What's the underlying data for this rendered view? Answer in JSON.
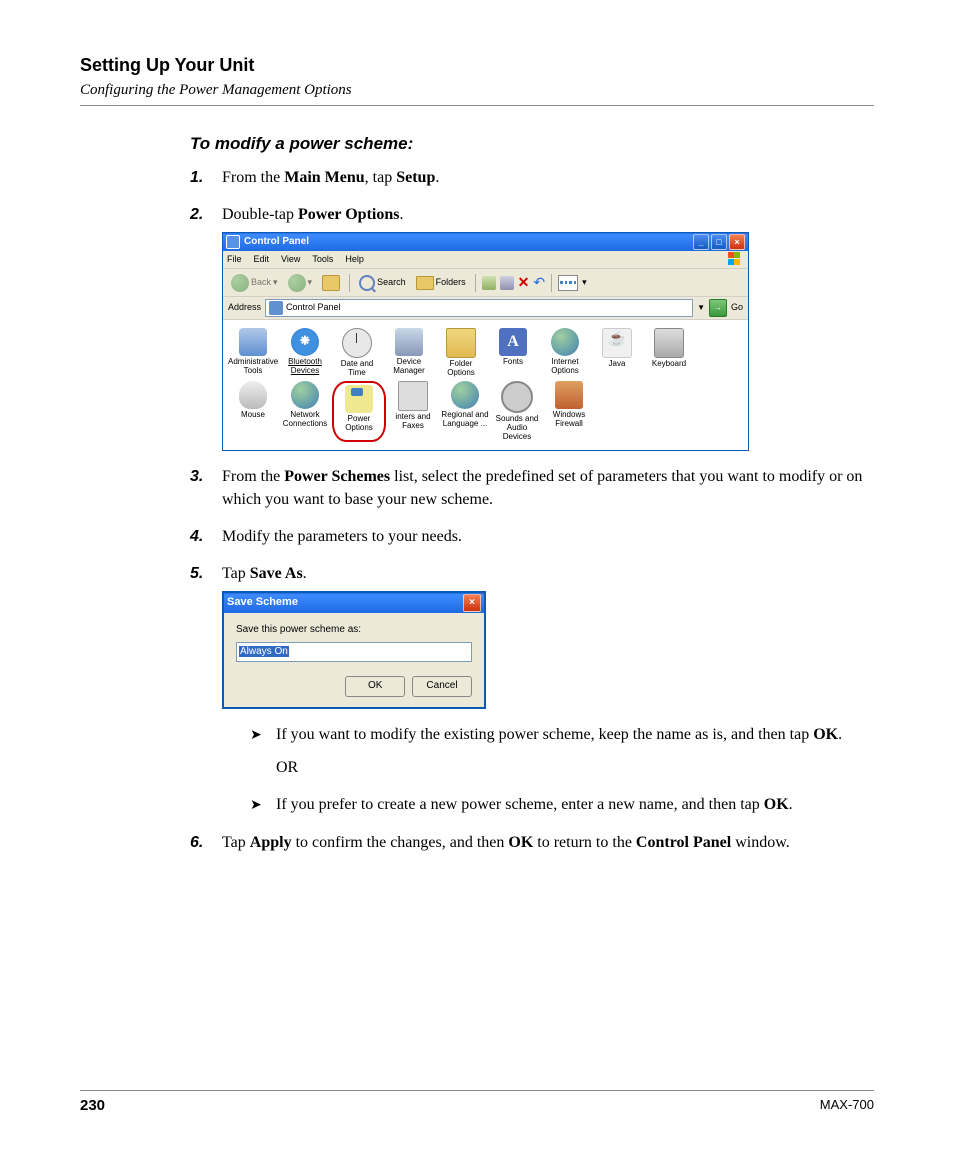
{
  "header": {
    "title": "Setting Up Your Unit",
    "subtitle": "Configuring the Power Management Options"
  },
  "instr_title": "To modify a power scheme:",
  "steps": {
    "s1": {
      "n": "1.",
      "pre": "From the ",
      "b1": "Main Menu",
      "mid": ", tap ",
      "b2": "Setup",
      "post": "."
    },
    "s2": {
      "n": "2.",
      "pre": "Double-tap ",
      "b1": "Power Options",
      "post": "."
    },
    "s3": {
      "n": "3.",
      "pre": "From the ",
      "b1": "Power Schemes",
      "post": " list, select the predefined set of parameters that you want to modify or on which you want to base your new scheme."
    },
    "s4": {
      "n": "4.",
      "text": "Modify the parameters to your needs."
    },
    "s5": {
      "n": "5.",
      "pre": "Tap ",
      "b1": "Save As",
      "post": "."
    },
    "s6": {
      "n": "6.",
      "pre": "Tap ",
      "b1": "Apply",
      "mid": " to confirm the changes, and then ",
      "b2": "OK",
      "mid2": " to return to the ",
      "b3": "Control Panel",
      "post": " window."
    }
  },
  "bullets": {
    "b1": {
      "pre": "If you want to modify the existing power scheme, keep the name as is, and then tap ",
      "b": "OK",
      "post": "."
    },
    "or": "OR",
    "b2": {
      "pre": "If you prefer to create a new power scheme, enter a new name, and then tap ",
      "b": "OK",
      "post": "."
    }
  },
  "cp": {
    "title": "Control Panel",
    "menu": {
      "file": "File",
      "edit": "Edit",
      "view": "View",
      "tools": "Tools",
      "help": "Help"
    },
    "toolbar": {
      "back": "Back",
      "search": "Search",
      "folders": "Folders"
    },
    "addr": {
      "label": "Address",
      "value": "Control Panel",
      "go": "Go"
    },
    "items": {
      "admin": "Administrative Tools",
      "bt": "Bluetooth Devices",
      "date": "Date and Time",
      "device": "Device Manager",
      "folderopt": "Folder Options",
      "fonts": "Fonts",
      "internet": "Internet Options",
      "java": "Java",
      "keyboard": "Keyboard",
      "mouse": "Mouse",
      "network": "Network Connections",
      "power": "Power Options",
      "printers": "inters and Faxes",
      "regional": "Regional and Language ...",
      "sounds": "Sounds and Audio Devices",
      "firewall": "Windows Firewall"
    }
  },
  "dialog": {
    "title": "Save Scheme",
    "label": "Save this power scheme as:",
    "value": "Always On",
    "ok": "OK",
    "cancel": "Cancel"
  },
  "footer": {
    "page": "230",
    "model": "MAX-700"
  }
}
